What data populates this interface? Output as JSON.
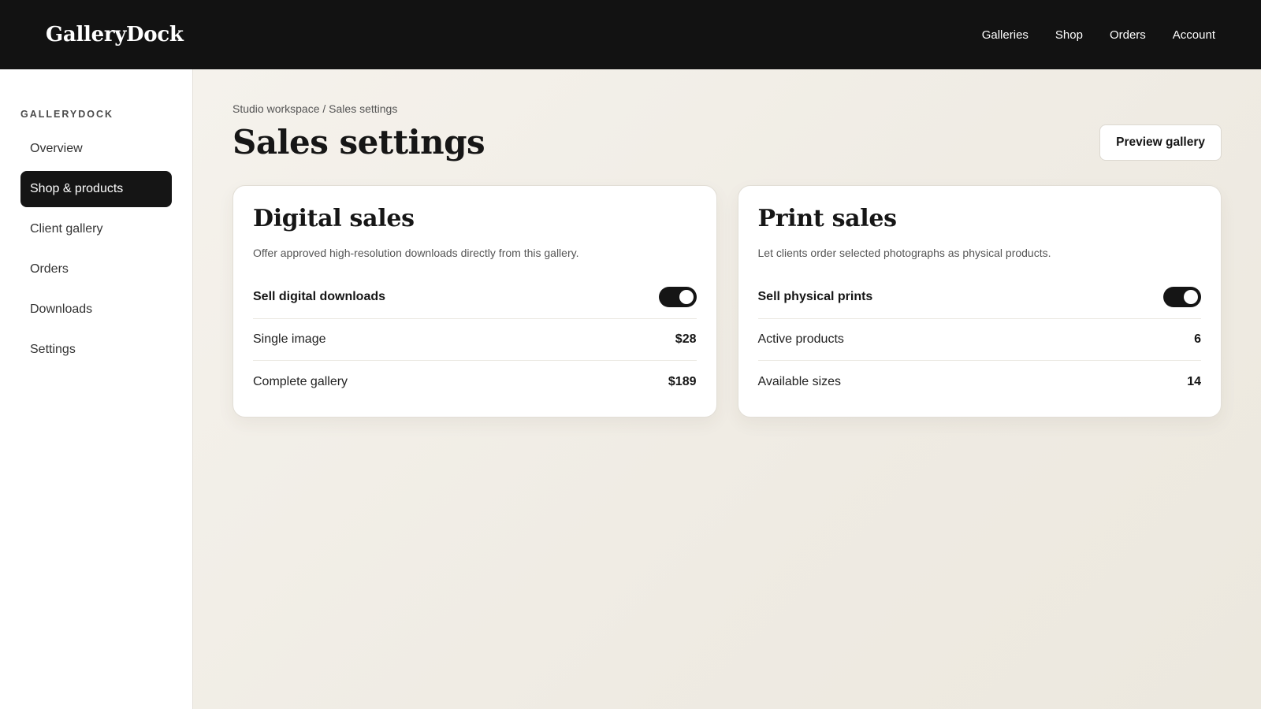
{
  "header": {
    "brand": "GalleryDock",
    "nav": [
      "Galleries",
      "Shop",
      "Orders",
      "Account"
    ]
  },
  "sidebar": {
    "heading": "GALLERYDOCK",
    "items": [
      {
        "label": "Overview",
        "active": false
      },
      {
        "label": "Shop & products",
        "active": true
      },
      {
        "label": "Client gallery",
        "active": false
      },
      {
        "label": "Orders",
        "active": false
      },
      {
        "label": "Downloads",
        "active": false
      },
      {
        "label": "Settings",
        "active": false
      }
    ]
  },
  "main": {
    "breadcrumb": "Studio workspace / Sales settings",
    "title": "Sales settings",
    "preview_button": "Preview gallery",
    "cards": [
      {
        "title": "Digital sales",
        "description": "Offer approved high-resolution downloads directly from this gallery.",
        "toggle_label": "Sell digital downloads",
        "toggle_on": true,
        "rows": [
          {
            "label": "Single image",
            "value": "$28"
          },
          {
            "label": "Complete gallery",
            "value": "$189"
          }
        ]
      },
      {
        "title": "Print sales",
        "description": "Let clients order selected photographs as physical products.",
        "toggle_label": "Sell physical prints",
        "toggle_on": true,
        "rows": [
          {
            "label": "Active products",
            "value": "6"
          },
          {
            "label": "Available sizes",
            "value": "14"
          }
        ]
      }
    ]
  },
  "colors": {
    "topbar": "#121212",
    "accent": "#151515",
    "background": "#f2efe8"
  }
}
